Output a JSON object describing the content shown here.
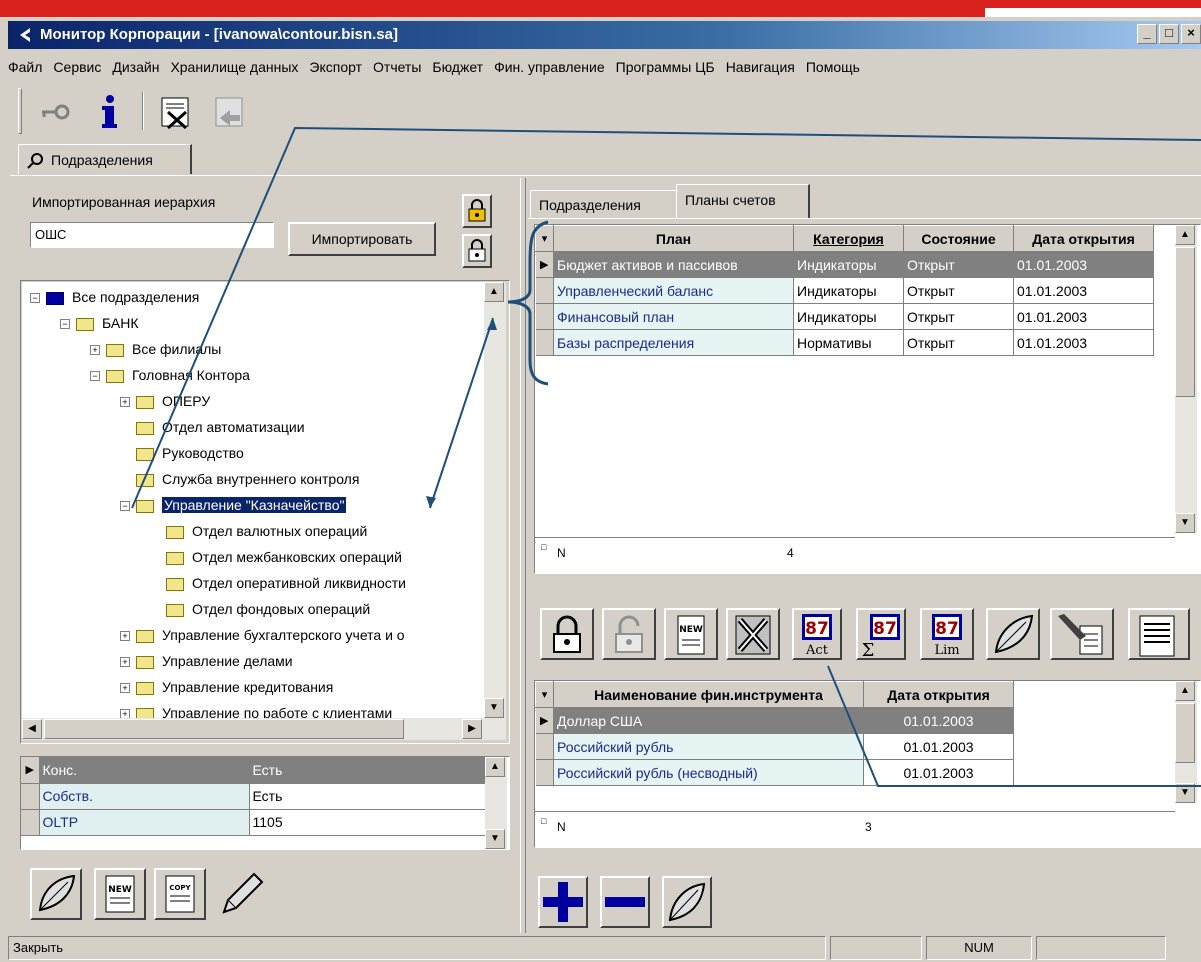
{
  "window": {
    "title": "Монитор Корпорации - [ivanowa\\contour.bisn.sa]",
    "minimize": "_",
    "maximize": "□",
    "close": "×"
  },
  "menu": [
    "Файл",
    "Сервис",
    "Дизайн",
    "Хранилище данных",
    "Экспорт",
    "Отчеты",
    "Бюджет",
    "Фин. управление",
    "Программы ЦБ",
    "Навигация",
    "Помощь"
  ],
  "main_tab": "Подразделения",
  "left": {
    "hierarchy_label": "Импортированная иерархия",
    "hierarchy_value": "ОШС",
    "import_button": "Импортировать",
    "tree": [
      {
        "label": "Все подразделения",
        "level": 0,
        "exp": "−",
        "blue": true
      },
      {
        "label": "БАНК",
        "level": 1,
        "exp": "−"
      },
      {
        "label": "Все филиалы",
        "level": 2,
        "exp": "+"
      },
      {
        "label": "Головная Контора",
        "level": 2,
        "exp": "−"
      },
      {
        "label": "ОПЕРУ",
        "level": 3,
        "exp": "+"
      },
      {
        "label": "Отдел автоматизации",
        "level": 3,
        "exp": ""
      },
      {
        "label": "Руководство",
        "level": 3,
        "exp": ""
      },
      {
        "label": "Служба внутреннего контроля",
        "level": 3,
        "exp": ""
      },
      {
        "label": "Управление \"Казначейство\"",
        "level": 3,
        "exp": "−",
        "selected": true
      },
      {
        "label": "Отдел валютных операций",
        "level": 4,
        "exp": ""
      },
      {
        "label": "Отдел межбанковских операций",
        "level": 4,
        "exp": ""
      },
      {
        "label": "Отдел оперативной ликвидности",
        "level": 4,
        "exp": ""
      },
      {
        "label": "Отдел фондовых операций",
        "level": 4,
        "exp": ""
      },
      {
        "label": "Управление бухгалтерского учета и о",
        "level": 3,
        "exp": "+"
      },
      {
        "label": "Управление делами",
        "level": 3,
        "exp": "+"
      },
      {
        "label": "Управление кредитования",
        "level": 3,
        "exp": "+"
      },
      {
        "label": "Управление по работе с клиентами",
        "level": 3,
        "exp": "+"
      }
    ],
    "props": [
      {
        "name": "Конс.",
        "value": "Есть",
        "selected": true
      },
      {
        "name": "Собств.",
        "value": "Есть"
      },
      {
        "name": "OLTP",
        "value": "1105"
      }
    ]
  },
  "right": {
    "tabs": [
      "Подразделения",
      "Планы счетов"
    ],
    "plans": {
      "headers": [
        "План",
        "Категория",
        "Состояние",
        "Дата открытия"
      ],
      "rows": [
        [
          "Бюджет активов и пассивов",
          "Индикаторы",
          "Открыт",
          "01.01.2003"
        ],
        [
          "Управленческий баланс",
          "Индикаторы",
          "Открыт",
          "01.01.2003"
        ],
        [
          "Финансовый план",
          "Индикаторы",
          "Открыт",
          "01.01.2003"
        ],
        [
          "Базы распределения",
          "Нормативы",
          "Открыт",
          "01.01.2003"
        ]
      ],
      "footer_label": "N",
      "footer_count": "4"
    },
    "toolbar_labels": {
      "act": "Act",
      "sum": "Σ",
      "lim": "Lim",
      "e7": "87"
    },
    "instruments": {
      "headers": [
        "Наименование фин.инструмента",
        "Дата открытия"
      ],
      "rows": [
        [
          "Доллар США",
          "01.01.2003"
        ],
        [
          "Российский рубль",
          "01.01.2003"
        ],
        [
          "Российский рубль (несводный)",
          "01.01.2003"
        ]
      ],
      "footer_label": "N",
      "footer_count": "3"
    }
  },
  "status": {
    "text": "Закрыть",
    "num": "NUM"
  },
  "icons": {
    "new": "NEW",
    "copy": "COPY"
  }
}
